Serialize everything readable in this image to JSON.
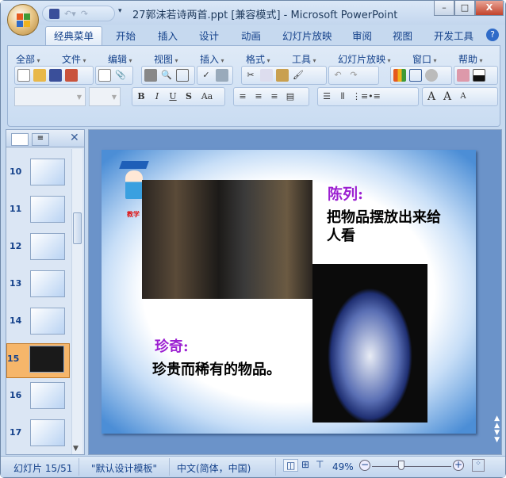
{
  "window": {
    "title": "27郭沫若诗两首.ppt [兼容模式] - Microsoft PowerPoint",
    "minimize": "–",
    "maximize": "□",
    "close": "X"
  },
  "ribbon_tabs": [
    "经典菜单",
    "开始",
    "插入",
    "设计",
    "动画",
    "幻灯片放映",
    "审阅",
    "视图",
    "开发工具"
  ],
  "menus": [
    "全部",
    "文件",
    "编辑",
    "视图",
    "插入",
    "格式",
    "工具",
    "幻灯片放映",
    "窗口",
    "帮助"
  ],
  "format_buttons": {
    "bold": "B",
    "italic": "I",
    "underline": "U",
    "shadow": "S",
    "case": "Aa",
    "grow": "A",
    "font_a": "A",
    "shrink": "A"
  },
  "thumbnails": [
    {
      "num": "10"
    },
    {
      "num": "11"
    },
    {
      "num": "12"
    },
    {
      "num": "13"
    },
    {
      "num": "14"
    },
    {
      "num": "15",
      "selected": true
    },
    {
      "num": "16"
    },
    {
      "num": "17"
    }
  ],
  "slide": {
    "logo_text": "教学",
    "heading1": "陈列:",
    "body1": "把物品摆放出来给人看",
    "heading2": "珍奇:",
    "body2": "珍贵而稀有的物品。",
    "accent": "#9b1fd1"
  },
  "status": {
    "slide": "幻灯片 15/51",
    "template": "\"默认设计模板\"",
    "language": "中文(简体，中国)",
    "zoom": "49%",
    "zoom_fraction": 0.49
  }
}
